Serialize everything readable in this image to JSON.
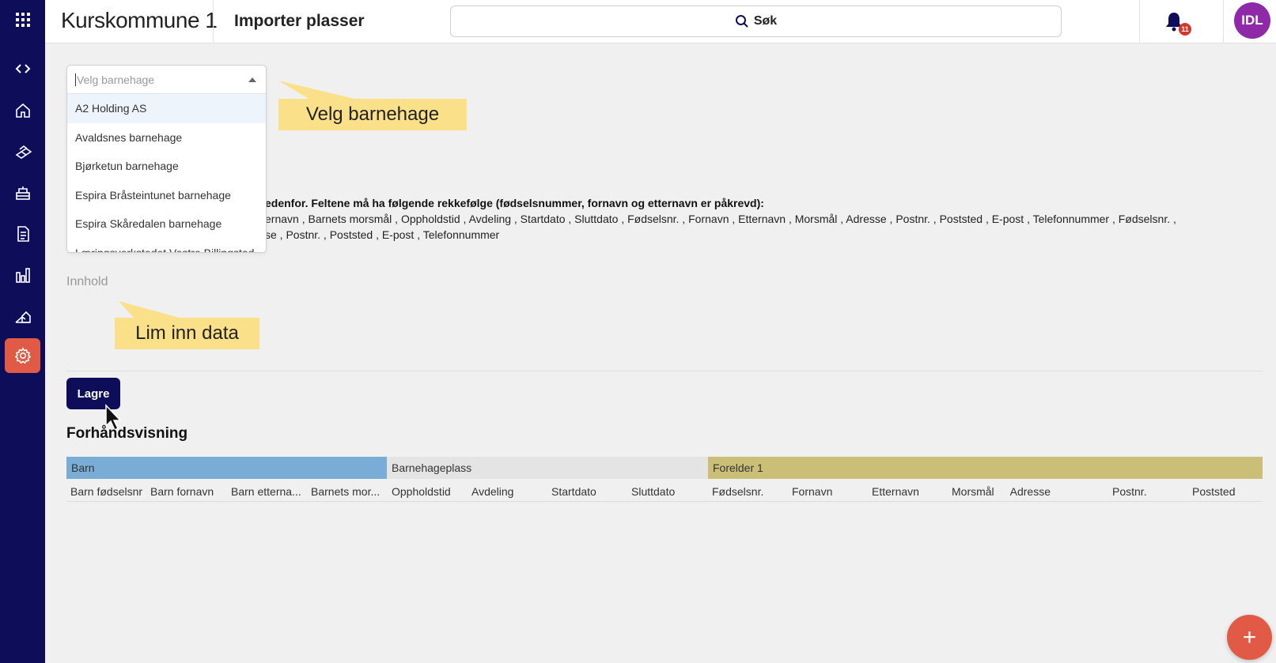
{
  "header": {
    "app_title": "Kurskommune 1",
    "page_title": "Importer plasser",
    "search_label": "Søk",
    "notification_count": "11",
    "avatar_initials": "IDL"
  },
  "sidebar": {
    "items": [
      {
        "icon": "apps-grid-icon"
      },
      {
        "icon": "code-icon"
      },
      {
        "icon": "home-icon"
      },
      {
        "icon": "blocks-icon"
      },
      {
        "icon": "building-icon"
      },
      {
        "icon": "document-icon"
      },
      {
        "icon": "bar-chart-icon"
      },
      {
        "icon": "houses-icon"
      },
      {
        "icon": "gear-icon",
        "active": true
      }
    ],
    "colors": {
      "background": "#0d0d5a",
      "active": "#e05a45"
    }
  },
  "dropdown": {
    "placeholder": "Velg barnehage",
    "options": [
      "A2 Holding AS",
      "Avaldsnes barnehage",
      "Bjørketun barnehage",
      "Espira Bråsteintunet barnehage",
      "Espira Skåredalen barnehage",
      "Læringsverkstedet Vestre Billingstad"
    ]
  },
  "tooltips": {
    "select": "Velg barnehage",
    "paste": "Lim inn data"
  },
  "instructions": {
    "bold_line": "edenfor. Feltene må ha følgende rekkefølge (fødselsnummer, fornavn og etternavn er påkrevd):",
    "line1": "ernavn ,  Barnets morsmål ,  Oppholdstid ,  Avdeling ,  Startdato ,  Sluttdato ,  Fødselsnr. ,  Fornavn ,  Etternavn ,  Morsmål ,  Adresse ,  Postnr. ,  Poststed ,  E-post ,  Telefonnummer ,  Fødselsnr. ,",
    "line2": "se ,  Postnr. ,  Poststed ,  E-post ,  Telefonnummer"
  },
  "content_label": "Innhold",
  "save_button": "Lagre",
  "preview": {
    "title": "Forhåndsvisning",
    "groups": [
      {
        "label": "Barn",
        "color": "#7aadd6"
      },
      {
        "label": "Barnehageplass",
        "color": "#e4e4e4"
      },
      {
        "label": "Forelder 1",
        "color": "#cbbf78"
      }
    ],
    "columns": [
      "Barn fødselsnr",
      "Barn fornavn",
      "Barn etterna...",
      "Barnets mor...",
      "Oppholdstid",
      "Avdeling",
      "Startdato",
      "Sluttdato",
      "Fødselsnr.",
      "Fornavn",
      "Etternavn",
      "Morsmål",
      "Adresse",
      "Postnr.",
      "Poststed"
    ]
  },
  "fab_label": "+"
}
